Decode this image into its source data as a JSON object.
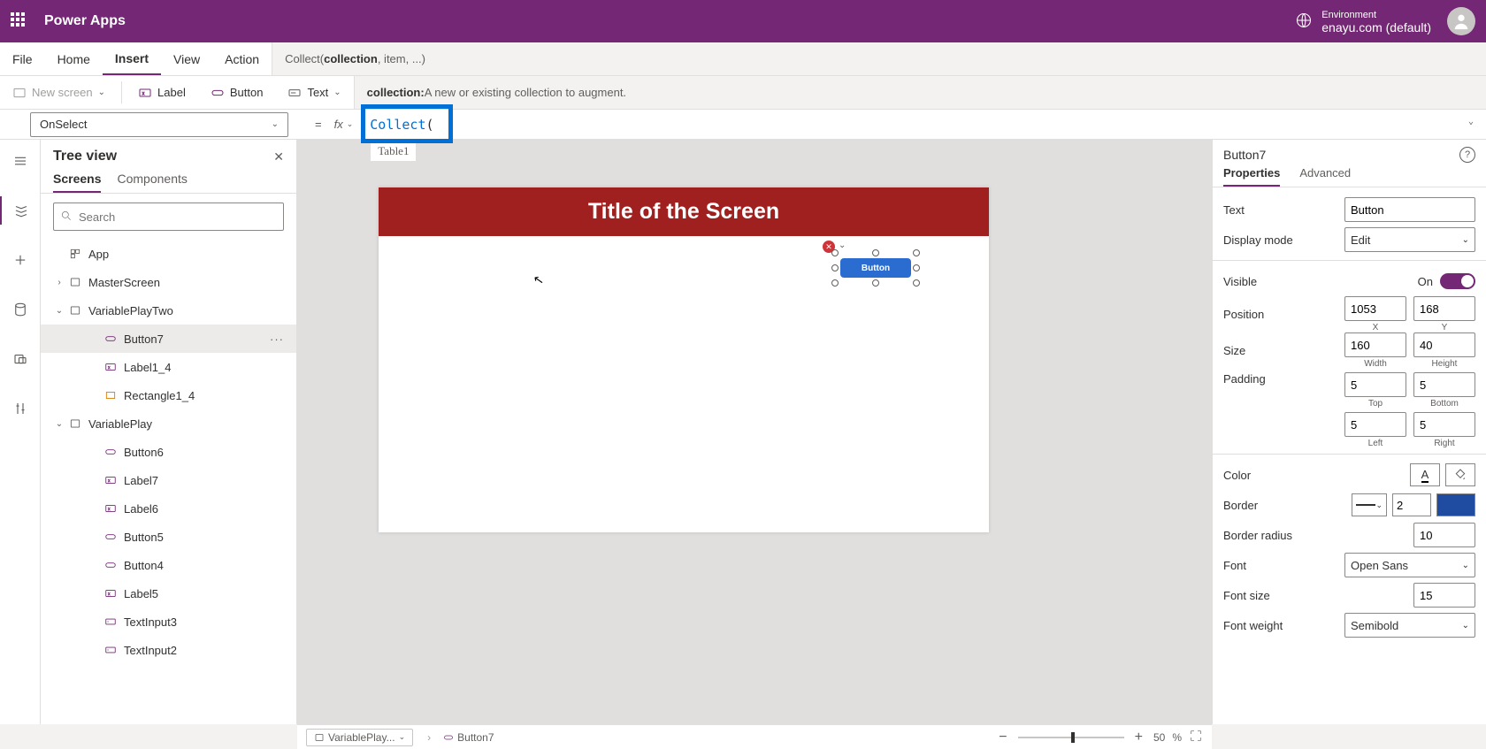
{
  "header": {
    "app_title": "Power Apps",
    "env_label": "Environment",
    "env_value": "enayu.com (default)"
  },
  "menubar": {
    "items": [
      "File",
      "Home",
      "Insert",
      "View",
      "Action"
    ],
    "active": "Insert",
    "param_hint_prefix": "Collect(",
    "param_hint_bold": "collection",
    "param_hint_suffix": ", item, ...)"
  },
  "toolbar": {
    "new_screen": "New screen",
    "label": "Label",
    "button": "Button",
    "text": "Text",
    "param_desc_bold": "collection:",
    "param_desc_rest": " A new or existing collection to augment."
  },
  "formula": {
    "property": "OnSelect",
    "fx": "fx",
    "func": "Collect",
    "open_paren": "(",
    "suggestion": "Table1"
  },
  "tree": {
    "title": "Tree view",
    "tabs": [
      "Screens",
      "Components"
    ],
    "active_tab": "Screens",
    "search_placeholder": "Search",
    "items": [
      {
        "name": "App",
        "icon": "app",
        "indent": 0,
        "exp": ""
      },
      {
        "name": "MasterScreen",
        "icon": "screen",
        "indent": 0,
        "exp": "›"
      },
      {
        "name": "VariablePlayTwo",
        "icon": "screen",
        "indent": 0,
        "exp": "⌄"
      },
      {
        "name": "Button7",
        "icon": "button",
        "indent": 1,
        "selected": true,
        "dots": "···"
      },
      {
        "name": "Label1_4",
        "icon": "label",
        "indent": 1
      },
      {
        "name": "Rectangle1_4",
        "icon": "rect",
        "indent": 1
      },
      {
        "name": "VariablePlay",
        "icon": "screen",
        "indent": 0,
        "exp": "⌄"
      },
      {
        "name": "Button6",
        "icon": "button",
        "indent": 1
      },
      {
        "name": "Label7",
        "icon": "label",
        "indent": 1
      },
      {
        "name": "Label6",
        "icon": "label",
        "indent": 1
      },
      {
        "name": "Button5",
        "icon": "button",
        "indent": 1
      },
      {
        "name": "Button4",
        "icon": "button",
        "indent": 1
      },
      {
        "name": "Label5",
        "icon": "label",
        "indent": 1
      },
      {
        "name": "TextInput3",
        "icon": "input",
        "indent": 1
      },
      {
        "name": "TextInput2",
        "icon": "input",
        "indent": 1
      }
    ]
  },
  "canvas": {
    "screen_title": "Title of the Screen",
    "button_text": "Button"
  },
  "props": {
    "name": "Button7",
    "tabs": [
      "Properties",
      "Advanced"
    ],
    "active_tab": "Properties",
    "text_label": "Text",
    "text_value": "Button",
    "display_mode_label": "Display mode",
    "display_mode_value": "Edit",
    "visible_label": "Visible",
    "visible_value": "On",
    "position_label": "Position",
    "pos_x": "1053",
    "pos_y": "168",
    "pos_x_sub": "X",
    "pos_y_sub": "Y",
    "size_label": "Size",
    "width": "160",
    "height": "40",
    "width_sub": "Width",
    "height_sub": "Height",
    "padding_label": "Padding",
    "pad_top": "5",
    "pad_bottom": "5",
    "pad_left": "5",
    "pad_right": "5",
    "pad_top_sub": "Top",
    "pad_bottom_sub": "Bottom",
    "pad_left_sub": "Left",
    "pad_right_sub": "Right",
    "color_label": "Color",
    "color_letter": "A",
    "border_label": "Border",
    "border_width": "2",
    "border_radius_label": "Border radius",
    "border_radius": "10",
    "font_label": "Font",
    "font_value": "Open Sans",
    "font_size_label": "Font size",
    "font_size": "15",
    "font_weight_label": "Font weight",
    "font_weight": "Semibold"
  },
  "status": {
    "crumb1": "VariablePlay...",
    "crumb2": "Button7",
    "zoom": "50",
    "zoom_unit": "%"
  }
}
